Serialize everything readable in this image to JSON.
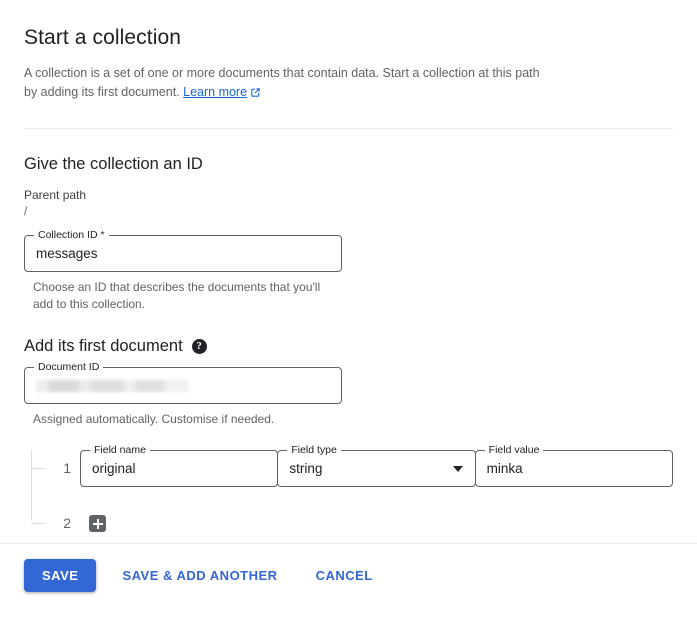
{
  "header": {
    "title": "Start a collection",
    "description_line1": "A collection is a set of one or more documents that contain data. Start a collection at this path",
    "description_line2": "by adding its first document.",
    "learn_more_label": "Learn more",
    "learn_more_icon": "external-link-icon"
  },
  "collection_section": {
    "title": "Give the collection an ID",
    "parent_path_label": "Parent path",
    "parent_path_value": "/",
    "collection_id": {
      "label": "Collection ID *",
      "value": "messages",
      "placeholder": ""
    },
    "hint": "Choose an ID that describes the documents that you'll add to this collection."
  },
  "document_section": {
    "title": "Add its first document",
    "help_icon": "help-circle-icon",
    "help_glyph": "?",
    "document_id": {
      "label": "Document ID",
      "value": "",
      "placeholder": ""
    },
    "hint": "Assigned automatically. Customise if needed."
  },
  "fields": {
    "name_label": "Field name",
    "type_label": "Field type",
    "value_label": "Field value",
    "rows": [
      {
        "index": "1",
        "name": "original",
        "type": "string",
        "value": "minka"
      }
    ],
    "add_row_index": "2",
    "add_button_icon": "plus-icon"
  },
  "footer": {
    "save_label": "SAVE",
    "save_add_another_label": "SAVE & ADD ANOTHER",
    "cancel_label": "CANCEL"
  },
  "colors": {
    "accent": "#3367d6",
    "link": "#1967d2",
    "text_primary": "#202124",
    "text_secondary": "#5f6368",
    "border": "#5f6368",
    "divider": "#e8eaed",
    "add_button": "#5f6368"
  }
}
